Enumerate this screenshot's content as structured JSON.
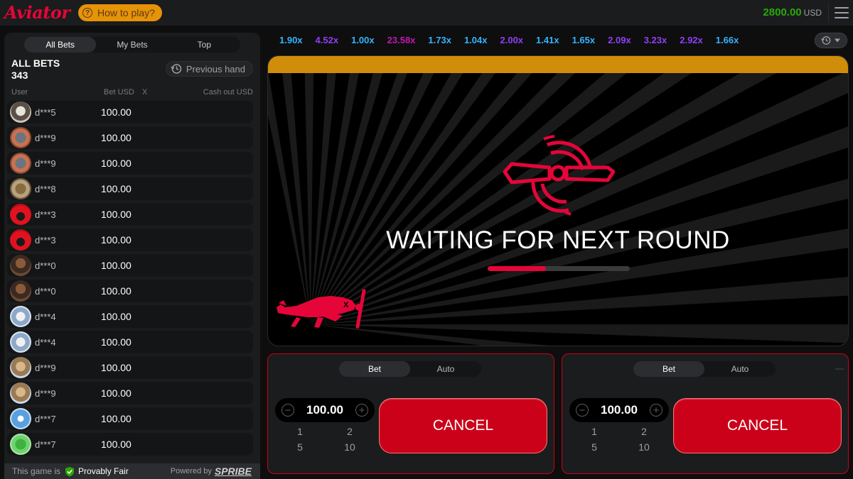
{
  "header": {
    "logo": "Aviator",
    "how_to_play": "How to play?",
    "balance": "2800.00",
    "currency": "USD"
  },
  "bets_panel": {
    "tabs": [
      {
        "label": "All Bets",
        "active": true
      },
      {
        "label": "My Bets",
        "active": false
      },
      {
        "label": "Top",
        "active": false
      }
    ],
    "title": "ALL BETS",
    "count": "343",
    "previous_hand": "Previous hand",
    "columns": {
      "user": "User",
      "bet": "Bet USD",
      "x": "X",
      "cashout": "Cash out USD"
    },
    "rows": [
      {
        "user": "d***5",
        "bet": "100.00",
        "avatar": "raccoon"
      },
      {
        "user": "d***9",
        "bet": "100.00",
        "avatar": "plane"
      },
      {
        "user": "d***9",
        "bet": "100.00",
        "avatar": "plane"
      },
      {
        "user": "d***8",
        "bet": "100.00",
        "avatar": "dog"
      },
      {
        "user": "d***3",
        "bet": "100.00",
        "avatar": "car"
      },
      {
        "user": "d***3",
        "bet": "100.00",
        "avatar": "car"
      },
      {
        "user": "d***0",
        "bet": "100.00",
        "avatar": "person"
      },
      {
        "user": "d***0",
        "bet": "100.00",
        "avatar": "person"
      },
      {
        "user": "d***4",
        "bet": "100.00",
        "avatar": "husky"
      },
      {
        "user": "d***4",
        "bet": "100.00",
        "avatar": "husky"
      },
      {
        "user": "d***9",
        "bet": "100.00",
        "avatar": "giraffe"
      },
      {
        "user": "d***9",
        "bet": "100.00",
        "avatar": "giraffe"
      },
      {
        "user": "d***7",
        "bet": "100.00",
        "avatar": "jet"
      },
      {
        "user": "d***7",
        "bet": "100.00",
        "avatar": "clover"
      }
    ],
    "footer": {
      "prefix": "This game is",
      "provably_fair": "Provably Fair",
      "powered_by": "Powered by",
      "brand": "SPRIBE"
    }
  },
  "history": [
    {
      "value": "1.90x",
      "color": "#34b4ff"
    },
    {
      "value": "4.52x",
      "color": "#913ef8"
    },
    {
      "value": "1.00x",
      "color": "#34b4ff"
    },
    {
      "value": "23.58x",
      "color": "#c017b4"
    },
    {
      "value": "1.73x",
      "color": "#34b4ff"
    },
    {
      "value": "1.04x",
      "color": "#34b4ff"
    },
    {
      "value": "2.00x",
      "color": "#913ef8"
    },
    {
      "value": "1.41x",
      "color": "#34b4ff"
    },
    {
      "value": "1.65x",
      "color": "#34b4ff"
    },
    {
      "value": "2.09x",
      "color": "#913ef8"
    },
    {
      "value": "3.23x",
      "color": "#913ef8"
    },
    {
      "value": "2.92x",
      "color": "#913ef8"
    },
    {
      "value": "1.66x",
      "color": "#34b4ff"
    }
  ],
  "game": {
    "status": "WAITING FOR NEXT ROUND",
    "progress": 0.41,
    "accent": "#e50539"
  },
  "bet_panels": [
    {
      "tabs": [
        {
          "label": "Bet",
          "active": true
        },
        {
          "label": "Auto",
          "active": false
        }
      ],
      "amount": "100.00",
      "quick": [
        "1",
        "2",
        "5",
        "10"
      ],
      "action": "CANCEL"
    },
    {
      "tabs": [
        {
          "label": "Bet",
          "active": true
        },
        {
          "label": "Auto",
          "active": false
        }
      ],
      "amount": "100.00",
      "quick": [
        "1",
        "2",
        "5",
        "10"
      ],
      "action": "CANCEL"
    }
  ]
}
